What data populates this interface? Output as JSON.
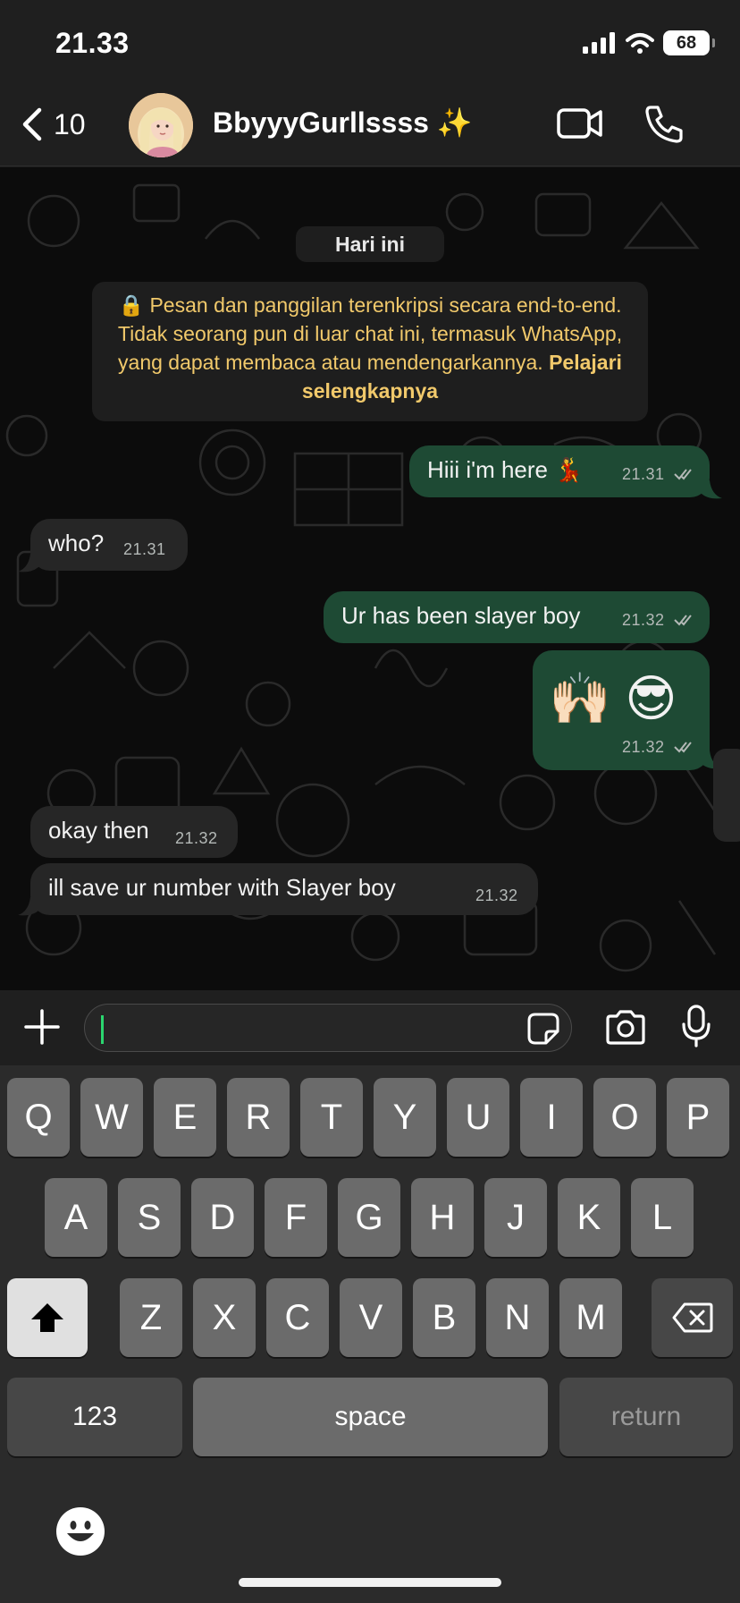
{
  "status": {
    "time": "21.33",
    "battery": "68"
  },
  "header": {
    "back_count": "10",
    "contact_name": "BbyyyGurllssss ✨"
  },
  "chat": {
    "date_chip": "Hari ini",
    "encryption": {
      "text": "🔒 Pesan dan panggilan terenkripsi secara end-to-end. Tidak seorang pun di luar chat ini, termasuk WhatsApp, yang dapat membaca atau mendengarkannya. ",
      "link": "Pelajari selengkapnya"
    },
    "messages": [
      {
        "direction": "out",
        "text": "Hiii i'm here 💃",
        "time": "21.31"
      },
      {
        "direction": "in",
        "text": "who?",
        "time": "21.31"
      },
      {
        "direction": "out",
        "text": "Ur has been slayer boy",
        "time": "21.32"
      },
      {
        "direction": "out",
        "text": "🙌🏻 😎",
        "time": "21.32"
      },
      {
        "direction": "in",
        "text": "okay then",
        "time": "21.32"
      },
      {
        "direction": "in",
        "text": "ill save ur number with Slayer boy",
        "time": "21.32"
      }
    ]
  },
  "composer": {
    "input_value": ""
  },
  "keyboard": {
    "row1": [
      "Q",
      "W",
      "E",
      "R",
      "T",
      "Y",
      "U",
      "I",
      "O",
      "P"
    ],
    "row2": [
      "A",
      "S",
      "D",
      "F",
      "G",
      "H",
      "J",
      "K",
      "L"
    ],
    "row3": [
      "Z",
      "X",
      "C",
      "V",
      "B",
      "N",
      "M"
    ],
    "numbers_label": "123",
    "space_label": "space",
    "return_label": "return"
  },
  "icons": {
    "back": "chevron-left-icon",
    "video_call": "video-camera-icon",
    "voice_call": "phone-icon",
    "attach": "plus-icon",
    "sticker": "sticker-icon",
    "camera": "camera-icon",
    "mic": "microphone-icon",
    "read_receipt": "double-check-icon",
    "shift": "shift-arrow-icon",
    "backspace": "backspace-icon",
    "emoji": "emoji-smile-icon"
  },
  "colors": {
    "outgoing_bubble": "#1e4a34",
    "incoming_bubble": "#262626",
    "encryption_text": "#f1c96b",
    "cursor": "#2bd66f"
  }
}
